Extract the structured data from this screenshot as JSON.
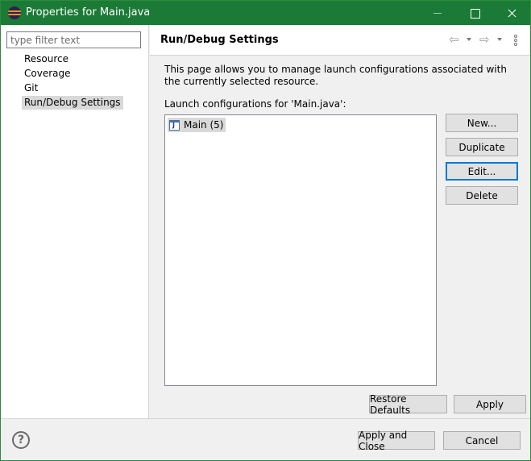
{
  "window": {
    "title": "Properties for Main.java"
  },
  "sidebar": {
    "filter_placeholder": "type filter text",
    "items": [
      {
        "label": "Resource"
      },
      {
        "label": "Coverage"
      },
      {
        "label": "Git"
      },
      {
        "label": "Run/Debug Settings",
        "selected": true
      }
    ]
  },
  "page": {
    "title": "Run/Debug Settings",
    "description": "This page allows you to manage launch configurations associated with the currently selected resource.",
    "list_label": "Launch configurations for 'Main.java':",
    "configurations": [
      {
        "label": "Main (5)",
        "icon": "java-launch-icon"
      }
    ],
    "buttons": {
      "new": "New...",
      "duplicate": "Duplicate",
      "edit": "Edit...",
      "delete": "Delete",
      "restore_defaults": "Restore Defaults",
      "apply": "Apply"
    }
  },
  "footer": {
    "help_icon": "?",
    "apply_and_close": "Apply and Close",
    "cancel": "Cancel"
  },
  "colors": {
    "titlebar": "#1b7a36",
    "selection": "#d9d9d9",
    "focus": "#0078d7"
  }
}
